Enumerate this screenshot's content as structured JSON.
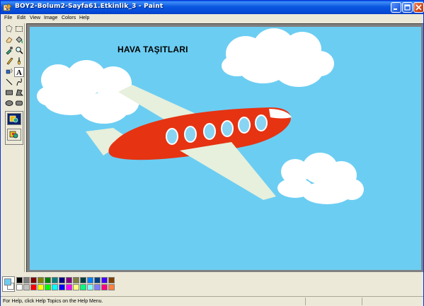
{
  "window": {
    "title": "BOY2-Bolum2-Sayfa61.Etkinlik_3 - Paint",
    "controls": [
      "minimize",
      "maximize",
      "close"
    ]
  },
  "menu": {
    "items": [
      "File",
      "Edit",
      "View",
      "Image",
      "Colors",
      "Help"
    ]
  },
  "toolbox": {
    "tools": [
      {
        "name": "free-form-select",
        "glyph": "⬚"
      },
      {
        "name": "select",
        "glyph": "▭"
      },
      {
        "name": "eraser",
        "glyph": "▱"
      },
      {
        "name": "fill-with-color",
        "glyph": "◈"
      },
      {
        "name": "pick-color",
        "glyph": "⚲"
      },
      {
        "name": "magnifier",
        "glyph": "🔍"
      },
      {
        "name": "pencil",
        "glyph": "✎"
      },
      {
        "name": "brush",
        "glyph": "♙"
      },
      {
        "name": "airbrush",
        "glyph": "⛟"
      },
      {
        "name": "text",
        "glyph": "A"
      },
      {
        "name": "line",
        "glyph": "╲"
      },
      {
        "name": "curve",
        "glyph": "∫"
      },
      {
        "name": "rectangle",
        "glyph": "▭"
      },
      {
        "name": "polygon",
        "glyph": "⏢"
      },
      {
        "name": "ellipse",
        "glyph": "⬭"
      },
      {
        "name": "rounded-rectangle",
        "glyph": "▢"
      }
    ],
    "active_tool": "text"
  },
  "canvas": {
    "text": "HAVA TAŞITLARI",
    "background_color": "#6ccdf2"
  },
  "palette": {
    "colors_row1": [
      "#000000",
      "#808080",
      "#800000",
      "#808000",
      "#008000",
      "#008080",
      "#000080",
      "#800080",
      "#808040",
      "#004040",
      "#0080ff",
      "#004080",
      "#4000ff",
      "#804000"
    ],
    "colors_row2": [
      "#ffffff",
      "#c0c0c0",
      "#ff0000",
      "#ffff00",
      "#00ff00",
      "#00ffff",
      "#0000ff",
      "#ff00ff",
      "#ffff80",
      "#00ff80",
      "#80ffff",
      "#8080ff",
      "#ff0080",
      "#ff8040"
    ],
    "foreground": "#6ccdf2",
    "background": "#ffffff"
  },
  "status": {
    "help_text": "For Help, click Help Topics on the Help Menu."
  }
}
